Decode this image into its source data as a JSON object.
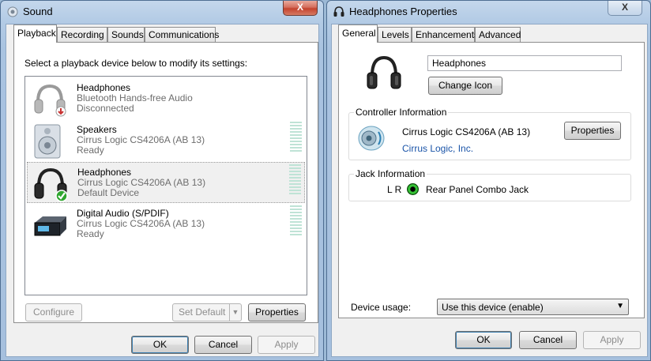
{
  "sound": {
    "title": "Sound",
    "close": "X",
    "tabs": [
      "Playback",
      "Recording",
      "Sounds",
      "Communications"
    ],
    "instruction": "Select a playback device below to modify its settings:",
    "devices": [
      {
        "name": "Headphones",
        "sub": "Bluetooth Hands-free Audio",
        "status": "Disconnected",
        "icon": "headphones-disconnected-icon"
      },
      {
        "name": "Speakers",
        "sub": "Cirrus Logic CS4206A (AB 13)",
        "status": "Ready",
        "icon": "speakers-icon"
      },
      {
        "name": "Headphones",
        "sub": "Cirrus Logic CS4206A (AB 13)",
        "status": "Default Device",
        "icon": "headphones-default-icon"
      },
      {
        "name": "Digital Audio (S/PDIF)",
        "sub": "Cirrus Logic CS4206A (AB 13)",
        "status": "Ready",
        "icon": "digital-audio-icon"
      }
    ],
    "configure": "Configure",
    "set_default": "Set Default",
    "properties": "Properties",
    "ok": "OK",
    "cancel": "Cancel",
    "apply": "Apply"
  },
  "props": {
    "title": "Headphones Properties",
    "tabs": [
      "General",
      "Levels",
      "Enhancements",
      "Advanced"
    ],
    "name_value": "Headphones",
    "change_icon": "Change Icon",
    "controller_label": "Controller Information",
    "controller_name": "Cirrus Logic CS4206A (AB 13)",
    "controller_link": "Cirrus Logic, Inc.",
    "properties": "Properties",
    "jack_label": "Jack Information",
    "jack_channels": "L R",
    "jack_name": "Rear Panel Combo Jack",
    "device_usage_label": "Device usage:",
    "device_usage_value": "Use this device (enable)",
    "ok": "OK",
    "cancel": "Cancel",
    "apply": "Apply"
  },
  "colors": {
    "jack": "#36c236",
    "link": "#1a54a8",
    "default_check": "#2fa62f"
  }
}
